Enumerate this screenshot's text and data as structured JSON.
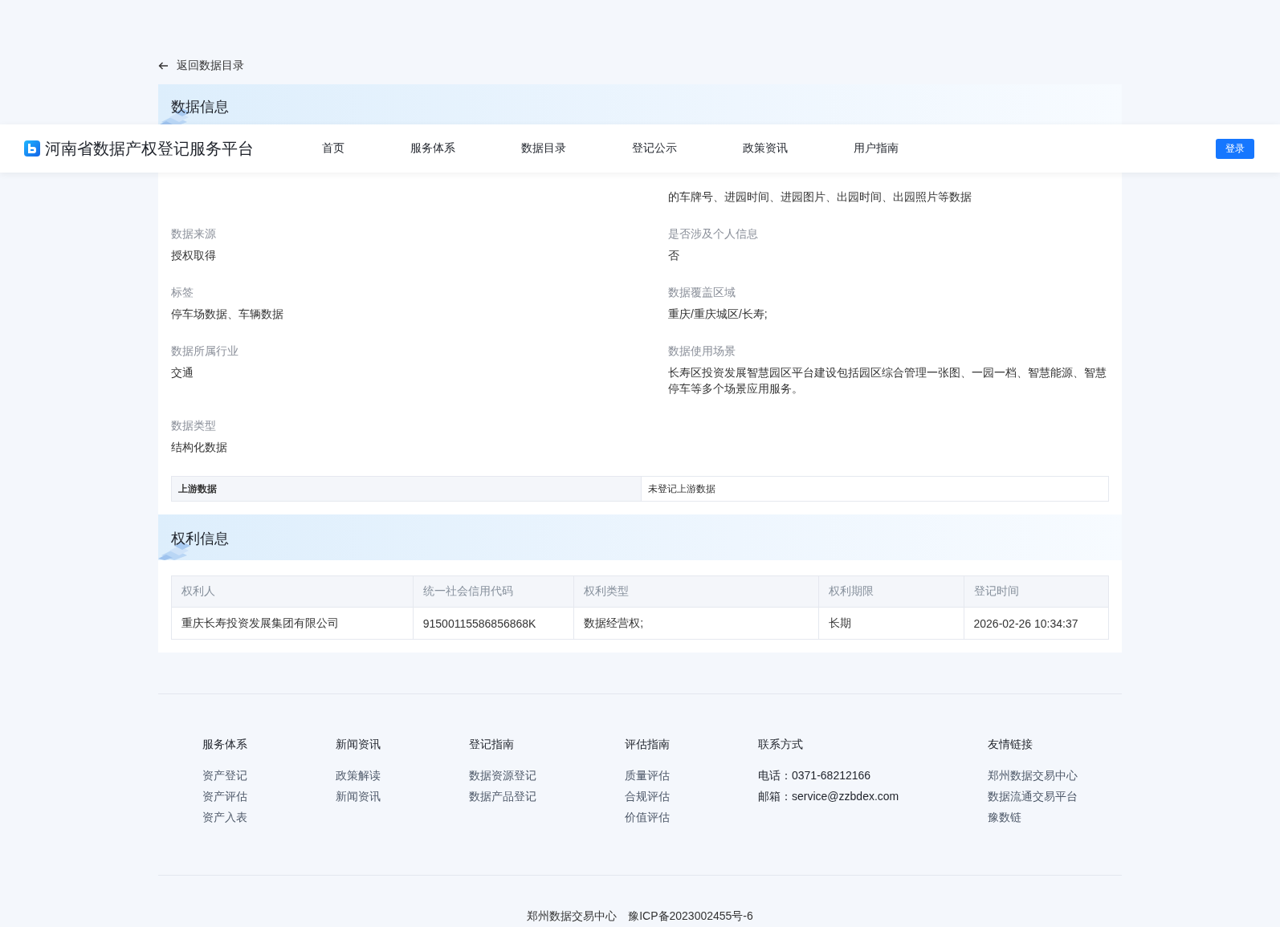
{
  "header": {
    "logo_title": "河南省数据产权登记服务平台",
    "nav": [
      {
        "label": "首页",
        "selected": false
      },
      {
        "label": "服务体系",
        "selected": false
      },
      {
        "label": "数据目录",
        "selected": false
      },
      {
        "label": "登记公示",
        "selected": false
      },
      {
        "label": "政策资讯",
        "selected": false
      },
      {
        "label": "用户指南",
        "selected": false
      }
    ],
    "login_button": "登录"
  },
  "back_link": "返回数据目录",
  "data_info": {
    "title": "数据信息",
    "fields": [
      {
        "value": "的车牌号、进园时间、进园图片、出园时间、出园照片等数据"
      },
      {
        "label": "数据来源",
        "value": "授权取得"
      },
      {
        "label": "是否涉及个人信息",
        "value": "否"
      },
      {
        "label": "标签",
        "value": "停车场数据、车辆数据"
      },
      {
        "label": "数据覆盖区域",
        "value": "重庆/重庆城区/长寿;"
      },
      {
        "label": "数据所属行业",
        "value": "交通"
      },
      {
        "label": "数据使用场景",
        "value": "长寿区投资发展智慧园区平台建设包括园区综合管理一张图、一园一档、智慧能源、智慧停车等多个场景应用服务。"
      },
      {
        "label": "数据类型",
        "value": "结构化数据"
      }
    ],
    "upstream": {
      "label": "上游数据",
      "value": "未登记上游数据"
    }
  },
  "rights_info": {
    "title": "权利信息",
    "columns": [
      "权利人",
      "统一社会信用代码",
      "权利类型",
      "权利期限",
      "登记时间"
    ],
    "rows": [
      [
        "重庆长寿投资发展集团有限公司",
        "91500115586856868K",
        "数据经营权;",
        "长期",
        "2026-02-26 10:34:37"
      ]
    ]
  },
  "footer": {
    "columns": [
      {
        "title": "服务体系",
        "kind": "links",
        "items": [
          "资产登记",
          "资产评估",
          "资产入表"
        ]
      },
      {
        "title": "新闻资讯",
        "kind": "links",
        "items": [
          "政策解读",
          "新闻资讯"
        ]
      },
      {
        "title": "登记指南",
        "kind": "links",
        "items": [
          "数据资源登记",
          "数据产品登记"
        ]
      },
      {
        "title": "评估指南",
        "kind": "links",
        "items": [
          "质量评估",
          "合规评估",
          "价值评估"
        ]
      },
      {
        "title": "联系方式",
        "kind": "contact",
        "items": [
          "电话：0371-68212166",
          "邮箱：service@zzbdex.com"
        ]
      },
      {
        "title": "友情链接",
        "kind": "links",
        "items": [
          "郑州数据交易中心",
          "数据流通交易平台",
          "豫数链"
        ]
      }
    ],
    "copyright": [
      "郑州数据交易中心",
      "豫ICP备2023002455号-6"
    ]
  }
}
